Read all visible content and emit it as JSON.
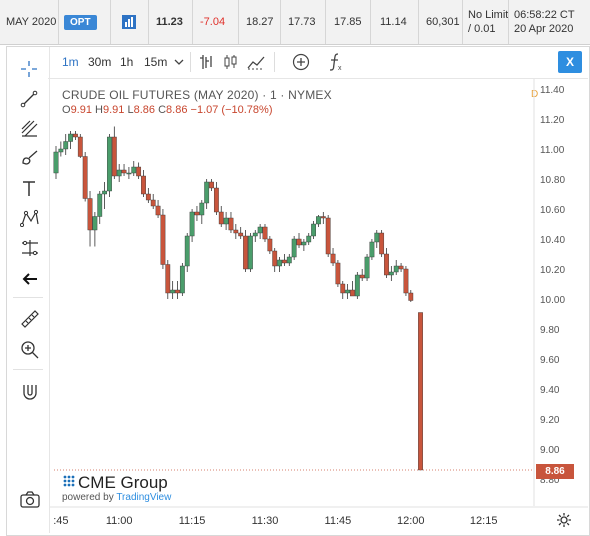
{
  "quote_bar": {
    "contract": "MAY 2020",
    "badge": "OPT",
    "chart_icon": "bar-chart-icon",
    "last": "11.23",
    "change": "-7.04",
    "prior_settle": "18.27",
    "open": "17.73",
    "high": "17.85",
    "low": "11.14",
    "volume": "60,301",
    "limit_line1": "No Limit",
    "limit_line2": "/ 0.01",
    "time": "06:58:22 CT",
    "date": "20 Apr 2020"
  },
  "toolbar": {
    "intervals": [
      "1m",
      "30m",
      "1h",
      "15m"
    ],
    "active_interval": "1m",
    "icons": [
      "chevron-down-icon",
      "bar-style-icon",
      "candle-style-icon",
      "indicators-icon",
      "add-compare-icon",
      "function-icon"
    ]
  },
  "close_label": "X",
  "side_tools": [
    "crosshair-icon",
    "trend-line-icon",
    "fib-icon",
    "brush-icon",
    "text-icon",
    "pattern-icon",
    "measure-icon",
    "back-arrow-icon",
    "ruler-icon",
    "zoom-in-icon",
    "magnet-icon",
    "camera-icon"
  ],
  "chart_info": {
    "title": "CRUDE OIL FUTURES (MAY 2020) · 1 · NYMEX",
    "o_label": "O",
    "o": "9.91",
    "h_label": "H",
    "h": "9.91",
    "l_label": "L",
    "l": "8.86",
    "c_label": "C",
    "c": "8.86",
    "chg": "−1.07 (−10.78%)",
    "d_marker": "D"
  },
  "branding": {
    "logo": "CME Group",
    "powered_prefix": "powered by",
    "powered_brand": "TradingView"
  },
  "last_price_tag": "8.86",
  "colors": {
    "up": "#4a9d6b",
    "down": "#c8553c",
    "accent": "#2e73c4",
    "negative": "#e0302a"
  },
  "chart_data": {
    "type": "candlestick",
    "title": "CRUDE OIL FUTURES (MAY 2020) · 1 · NYMEX",
    "y_ticks": [
      "11.40",
      "11.20",
      "11.00",
      "10.80",
      "10.60",
      "10.40",
      "10.20",
      "10.00",
      "9.80",
      "9.60",
      "9.40",
      "9.20",
      "9.00",
      "8.80"
    ],
    "x_ticks": [
      ":45",
      "11:00",
      "11:15",
      "11:30",
      "11:45",
      "12:00",
      "12:15"
    ],
    "ylim": [
      8.78,
      11.44
    ],
    "x_range": [
      0,
      93
    ],
    "x_tick_positions": [
      1,
      13,
      28,
      43,
      58,
      73,
      88
    ],
    "candles": [
      {
        "o": 10.84,
        "h": 11.02,
        "l": 10.8,
        "c": 10.98
      },
      {
        "o": 10.98,
        "h": 11.05,
        "l": 10.95,
        "c": 11.0
      },
      {
        "o": 11.0,
        "h": 11.1,
        "l": 10.96,
        "c": 11.05
      },
      {
        "o": 11.05,
        "h": 11.12,
        "l": 11.0,
        "c": 11.1
      },
      {
        "o": 11.1,
        "h": 11.12,
        "l": 11.06,
        "c": 11.08
      },
      {
        "o": 11.08,
        "h": 11.1,
        "l": 10.94,
        "c": 10.95
      },
      {
        "o": 10.95,
        "h": 10.98,
        "l": 10.65,
        "c": 10.67
      },
      {
        "o": 10.67,
        "h": 10.72,
        "l": 10.35,
        "c": 10.46
      },
      {
        "o": 10.46,
        "h": 10.58,
        "l": 10.35,
        "c": 10.55
      },
      {
        "o": 10.55,
        "h": 10.72,
        "l": 10.5,
        "c": 10.7
      },
      {
        "o": 10.7,
        "h": 10.78,
        "l": 10.6,
        "c": 10.72
      },
      {
        "o": 10.72,
        "h": 11.1,
        "l": 10.68,
        "c": 11.08
      },
      {
        "o": 11.08,
        "h": 11.15,
        "l": 10.8,
        "c": 10.82
      },
      {
        "o": 10.82,
        "h": 10.9,
        "l": 10.78,
        "c": 10.86
      },
      {
        "o": 10.86,
        "h": 10.9,
        "l": 10.82,
        "c": 10.84
      },
      {
        "o": 10.84,
        "h": 10.88,
        "l": 10.8,
        "c": 10.84
      },
      {
        "o": 10.84,
        "h": 10.92,
        "l": 10.82,
        "c": 10.88
      },
      {
        "o": 10.88,
        "h": 10.91,
        "l": 10.8,
        "c": 10.82
      },
      {
        "o": 10.82,
        "h": 10.86,
        "l": 10.68,
        "c": 10.7
      },
      {
        "o": 10.7,
        "h": 10.74,
        "l": 10.64,
        "c": 10.66
      },
      {
        "o": 10.66,
        "h": 10.7,
        "l": 10.6,
        "c": 10.62
      },
      {
        "o": 10.62,
        "h": 10.66,
        "l": 10.54,
        "c": 10.56
      },
      {
        "o": 10.56,
        "h": 10.6,
        "l": 10.2,
        "c": 10.23
      },
      {
        "o": 10.23,
        "h": 10.26,
        "l": 10.0,
        "c": 10.04
      },
      {
        "o": 10.04,
        "h": 10.12,
        "l": 10.0,
        "c": 10.06
      },
      {
        "o": 10.06,
        "h": 10.12,
        "l": 10.0,
        "c": 10.04
      },
      {
        "o": 10.04,
        "h": 10.24,
        "l": 10.02,
        "c": 10.22
      },
      {
        "o": 10.22,
        "h": 10.44,
        "l": 10.18,
        "c": 10.42
      },
      {
        "o": 10.42,
        "h": 10.6,
        "l": 10.38,
        "c": 10.58
      },
      {
        "o": 10.58,
        "h": 10.62,
        "l": 10.52,
        "c": 10.56
      },
      {
        "o": 10.56,
        "h": 10.66,
        "l": 10.5,
        "c": 10.64
      },
      {
        "o": 10.64,
        "h": 10.8,
        "l": 10.6,
        "c": 10.78
      },
      {
        "o": 10.78,
        "h": 10.8,
        "l": 10.72,
        "c": 10.74
      },
      {
        "o": 10.74,
        "h": 10.78,
        "l": 10.56,
        "c": 10.58
      },
      {
        "o": 10.58,
        "h": 10.62,
        "l": 10.48,
        "c": 10.5
      },
      {
        "o": 10.5,
        "h": 10.58,
        "l": 10.46,
        "c": 10.54
      },
      {
        "o": 10.54,
        "h": 10.58,
        "l": 10.44,
        "c": 10.46
      },
      {
        "o": 10.46,
        "h": 10.5,
        "l": 10.4,
        "c": 10.44
      },
      {
        "o": 10.44,
        "h": 10.48,
        "l": 10.4,
        "c": 10.42
      },
      {
        "o": 10.42,
        "h": 10.46,
        "l": 10.18,
        "c": 10.2
      },
      {
        "o": 10.2,
        "h": 10.44,
        "l": 10.18,
        "c": 10.42
      },
      {
        "o": 10.42,
        "h": 10.46,
        "l": 10.38,
        "c": 10.44
      },
      {
        "o": 10.44,
        "h": 10.5,
        "l": 10.4,
        "c": 10.48
      },
      {
        "o": 10.48,
        "h": 10.5,
        "l": 10.38,
        "c": 10.4
      },
      {
        "o": 10.4,
        "h": 10.42,
        "l": 10.3,
        "c": 10.32
      },
      {
        "o": 10.32,
        "h": 10.34,
        "l": 10.18,
        "c": 10.22
      },
      {
        "o": 10.22,
        "h": 10.28,
        "l": 10.18,
        "c": 10.26
      },
      {
        "o": 10.26,
        "h": 10.3,
        "l": 10.22,
        "c": 10.24
      },
      {
        "o": 10.24,
        "h": 10.3,
        "l": 10.22,
        "c": 10.28
      },
      {
        "o": 10.28,
        "h": 10.42,
        "l": 10.26,
        "c": 10.4
      },
      {
        "o": 10.4,
        "h": 10.44,
        "l": 10.34,
        "c": 10.36
      },
      {
        "o": 10.36,
        "h": 10.4,
        "l": 10.32,
        "c": 10.38
      },
      {
        "o": 10.38,
        "h": 10.44,
        "l": 10.36,
        "c": 10.42
      },
      {
        "o": 10.42,
        "h": 10.52,
        "l": 10.4,
        "c": 10.5
      },
      {
        "o": 10.5,
        "h": 10.56,
        "l": 10.48,
        "c": 10.55
      },
      {
        "o": 10.55,
        "h": 10.58,
        "l": 10.5,
        "c": 10.54
      },
      {
        "o": 10.54,
        "h": 10.56,
        "l": 10.28,
        "c": 10.3
      },
      {
        "o": 10.3,
        "h": 10.34,
        "l": 10.22,
        "c": 10.24
      },
      {
        "o": 10.24,
        "h": 10.26,
        "l": 10.08,
        "c": 10.1
      },
      {
        "o": 10.1,
        "h": 10.12,
        "l": 10.0,
        "c": 10.04
      },
      {
        "o": 10.04,
        "h": 10.1,
        "l": 10.0,
        "c": 10.06
      },
      {
        "o": 10.06,
        "h": 10.12,
        "l": 10.02,
        "c": 10.02
      },
      {
        "o": 10.02,
        "h": 10.18,
        "l": 10.0,
        "c": 10.16
      },
      {
        "o": 10.16,
        "h": 10.2,
        "l": 10.12,
        "c": 10.14
      },
      {
        "o": 10.14,
        "h": 10.3,
        "l": 10.12,
        "c": 10.28
      },
      {
        "o": 10.28,
        "h": 10.4,
        "l": 10.26,
        "c": 10.38
      },
      {
        "o": 10.38,
        "h": 10.46,
        "l": 10.34,
        "c": 10.44
      },
      {
        "o": 10.44,
        "h": 10.46,
        "l": 10.28,
        "c": 10.3
      },
      {
        "o": 10.3,
        "h": 10.34,
        "l": 10.14,
        "c": 10.16
      },
      {
        "o": 10.16,
        "h": 10.22,
        "l": 10.12,
        "c": 10.18
      },
      {
        "o": 10.18,
        "h": 10.26,
        "l": 10.16,
        "c": 10.22
      },
      {
        "o": 10.22,
        "h": 10.24,
        "l": 10.18,
        "c": 10.2
      },
      {
        "o": 10.2,
        "h": 10.22,
        "l": 10.02,
        "c": 10.04
      },
      {
        "o": 10.04,
        "h": 10.06,
        "l": 9.98,
        "c": 9.99
      },
      {
        "o": 9.91,
        "h": 9.91,
        "l": 8.86,
        "c": 8.86
      }
    ],
    "candle_x": [
      0,
      1,
      2,
      3,
      4,
      5,
      6,
      7,
      8,
      9,
      10,
      11,
      12,
      13,
      14,
      15,
      16,
      17,
      18,
      19,
      20,
      21,
      22,
      23,
      24,
      25,
      26,
      27,
      28,
      29,
      30,
      31,
      32,
      33,
      34,
      35,
      36,
      37,
      38,
      39,
      40,
      41,
      42,
      43,
      44,
      45,
      46,
      47,
      48,
      49,
      50,
      51,
      52,
      53,
      54,
      55,
      56,
      57,
      58,
      59,
      60,
      61,
      62,
      63,
      64,
      65,
      66,
      67,
      68,
      69,
      70,
      71,
      72,
      73,
      75
    ],
    "last_price": 8.86
  }
}
